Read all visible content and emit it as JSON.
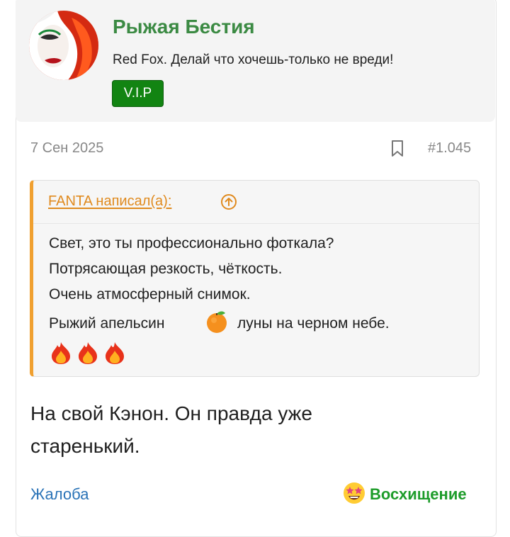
{
  "user": {
    "name": "Рыжая Бестия",
    "title": "Red Fox. Делай что хочешь-только не вреди!",
    "badge": "V.I.P",
    "avatar": "avatar-redhead-woman"
  },
  "post": {
    "date": "7 Сен 2025",
    "number": "#1.045",
    "bookmark_icon": "bookmark-icon",
    "quote": {
      "author": "FANTA написал(а):",
      "lines": [
        "Свет, это ты профессионально фоткала?",
        "Потрясающая резкость, чёткость.",
        "Очень атмосферный снимок."
      ],
      "line4_before": "Рыжий апельсин",
      "line4_after": "луны на черном небе.",
      "emoji": [
        "orange-emoji",
        "fire-emoji",
        "fire-emoji",
        "fire-emoji"
      ]
    },
    "body": [
      "На свой Кэнон. Он правда уже",
      "старенький."
    ]
  },
  "footer": {
    "report": "Жалоба",
    "reaction": "Восхищение",
    "reaction_icon": "star-struck-emoji"
  },
  "colors": {
    "username": "#3b8a43",
    "badge": "#128412",
    "quote_accent": "#f0a030",
    "link": "#2a73b7",
    "reaction": "#1d9c2a"
  }
}
